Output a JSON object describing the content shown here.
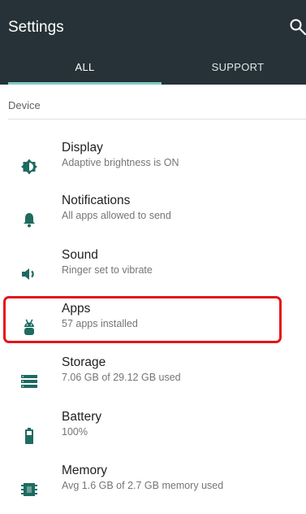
{
  "header": {
    "title": "Settings"
  },
  "tabs": [
    {
      "label": "ALL"
    },
    {
      "label": "SUPPORT"
    }
  ],
  "section": {
    "label": "Device"
  },
  "items": [
    {
      "icon": "brightness-icon",
      "label": "Display",
      "summary": "Adaptive brightness is ON"
    },
    {
      "icon": "bell-icon",
      "label": "Notifications",
      "summary": "All apps allowed to send"
    },
    {
      "icon": "volume-icon",
      "label": "Sound",
      "summary": "Ringer set to vibrate"
    },
    {
      "icon": "android-icon",
      "label": "Apps",
      "summary": "57 apps installed"
    },
    {
      "icon": "storage-icon",
      "label": "Storage",
      "summary": "7.06 GB of 29.12 GB used"
    },
    {
      "icon": "battery-icon",
      "label": "Battery",
      "summary": "100%"
    },
    {
      "icon": "memory-icon",
      "label": "Memory",
      "summary": "Avg 1.6 GB of 2.7 GB memory used"
    }
  ],
  "colors": {
    "appbar": "#263238",
    "icon": "#1e6b61",
    "tab_indicator": "#7fcbc4",
    "highlight": "#e3151a"
  }
}
